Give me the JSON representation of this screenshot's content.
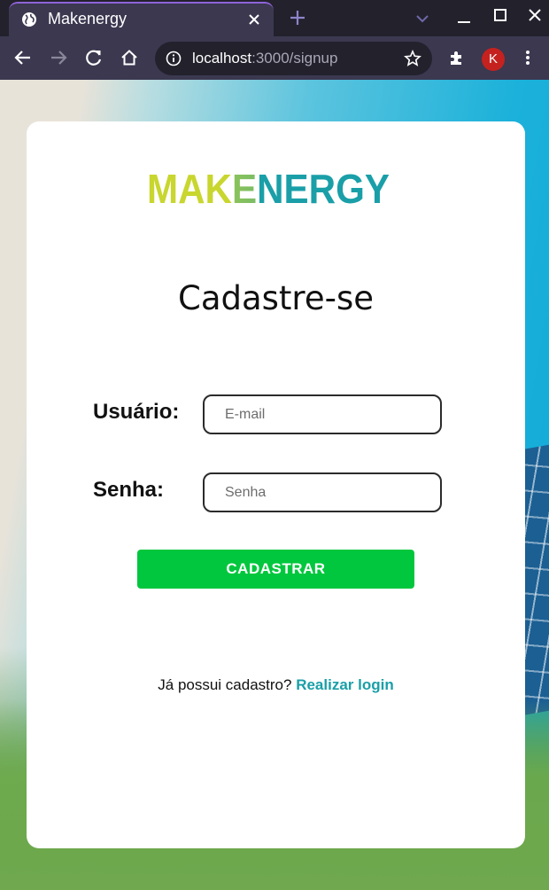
{
  "browser": {
    "tab_title": "Makenergy",
    "url_host": "localhost",
    "url_rest": ":3000/signup",
    "profile_initial": "K",
    "accent": "#8e64d8"
  },
  "page": {
    "logo": {
      "part1": "MAK",
      "part2": "E",
      "part3": "NERGY",
      "color1": "#c9d62f",
      "color2": "#1a9fa8"
    },
    "title": "Cadastre-se",
    "user_label": "Usuário:",
    "email_placeholder": "E-mail",
    "password_label": "Senha:",
    "password_placeholder": "Senha",
    "submit_label": "CADASTRAR",
    "submit_color": "#00c73d",
    "footer_text": "Já possui cadastro? ",
    "login_link": "Realizar login",
    "link_color": "#1a9fa8"
  }
}
